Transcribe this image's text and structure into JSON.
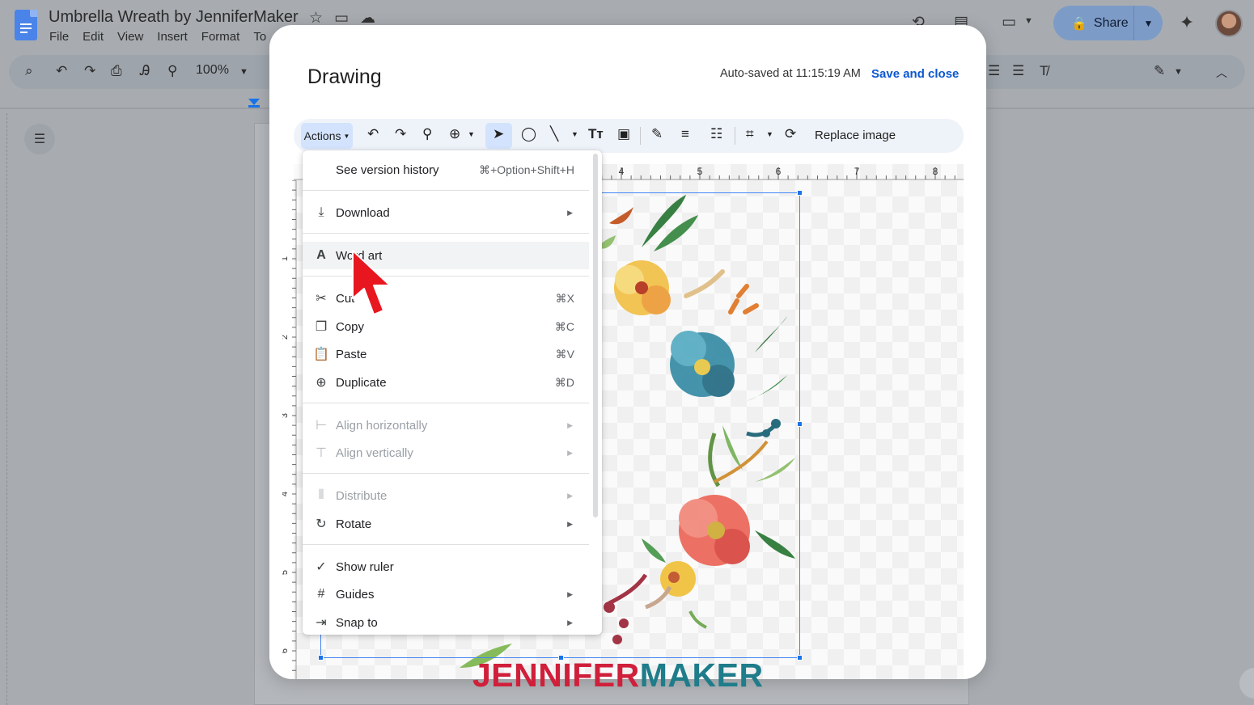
{
  "docs": {
    "title": "Umbrella Wreath by JenniferMaker",
    "menu": [
      "File",
      "Edit",
      "View",
      "Insert",
      "Format",
      "To"
    ],
    "share_label": "Share",
    "zoom": "100%"
  },
  "dialog": {
    "title": "Drawing",
    "autosave": "Auto-saved at 11:15:19 AM",
    "save_close": "Save and close",
    "actions_label": "Actions",
    "replace_image": "Replace image"
  },
  "menu": {
    "items": [
      {
        "label": "See version history",
        "shortcut": "⌘+Option+Shift+H",
        "icon": "none"
      },
      {
        "label": "Download",
        "submenu": true,
        "icon": "download-icon"
      },
      {
        "label": "Word art",
        "icon": "word-art-icon"
      },
      {
        "label": "Cut",
        "shortcut": "⌘X",
        "icon": "scissors-icon"
      },
      {
        "label": "Copy",
        "shortcut": "⌘C",
        "icon": "copy-icon"
      },
      {
        "label": "Paste",
        "shortcut": "⌘V",
        "icon": "clipboard-icon"
      },
      {
        "label": "Duplicate",
        "shortcut": "⌘D",
        "icon": "duplicate-icon"
      },
      {
        "label": "Align horizontally",
        "submenu": true,
        "disabled": true,
        "icon": "align-horizontal-icon"
      },
      {
        "label": "Align vertically",
        "submenu": true,
        "disabled": true,
        "icon": "align-vertical-icon"
      },
      {
        "label": "Distribute",
        "submenu": true,
        "disabled": true,
        "icon": "distribute-icon"
      },
      {
        "label": "Rotate",
        "submenu": true,
        "icon": "rotate-icon"
      },
      {
        "label": "Show ruler",
        "icon": "check-icon"
      },
      {
        "label": "Guides",
        "submenu": true,
        "icon": "grid-icon"
      },
      {
        "label": "Snap to",
        "submenu": true,
        "icon": "snap-icon"
      }
    ]
  },
  "ruler": {
    "horizontal": [
      "4",
      "5",
      "6",
      "7",
      "8"
    ],
    "vertical": [
      "1",
      "2",
      "3",
      "4",
      "5",
      "6"
    ]
  },
  "watermark": {
    "part1": "JENNIFER",
    "part2": "MAKER"
  }
}
